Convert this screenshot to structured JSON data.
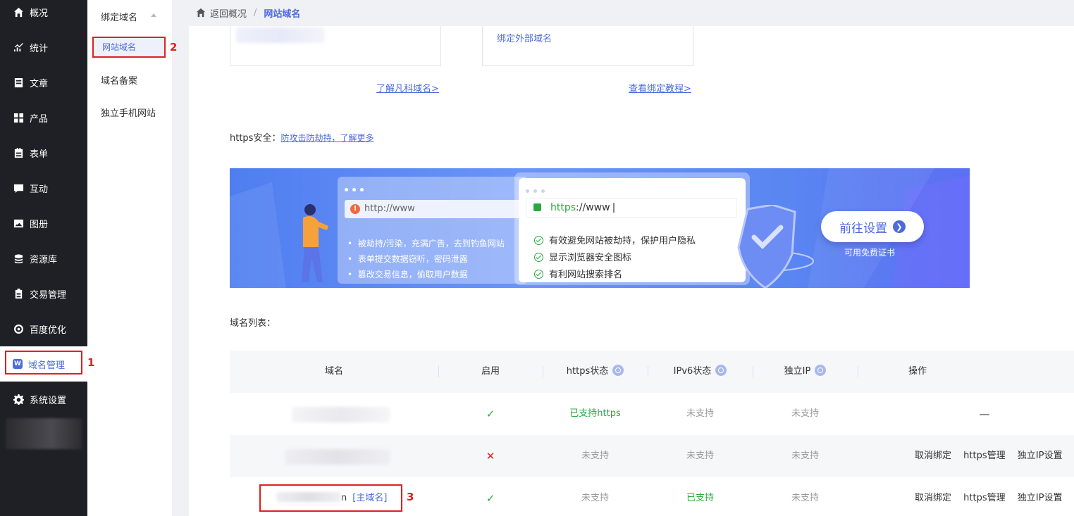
{
  "nav": {
    "items": [
      {
        "label": "概况",
        "icon": "home-icon"
      },
      {
        "label": "统计",
        "icon": "chart-icon"
      },
      {
        "label": "文章",
        "icon": "article-icon"
      },
      {
        "label": "产品",
        "icon": "grid-icon"
      },
      {
        "label": "表单",
        "icon": "form-icon"
      },
      {
        "label": "互动",
        "icon": "chat-icon"
      },
      {
        "label": "图册",
        "icon": "gallery-icon"
      },
      {
        "label": "资源库",
        "icon": "database-icon"
      },
      {
        "label": "交易管理",
        "icon": "clipboard-icon"
      },
      {
        "label": "百度优化",
        "icon": "target-icon"
      },
      {
        "label": "域名管理",
        "icon": "w-icon",
        "badge": "W"
      },
      {
        "label": "系统设置",
        "icon": "gear-icon"
      }
    ]
  },
  "subnav": {
    "group_title": "绑定域名",
    "items": [
      {
        "label": "网站域名"
      },
      {
        "label": "域名备案"
      },
      {
        "label": "独立手机网站"
      }
    ]
  },
  "breadcrumb": {
    "back": "返回概况",
    "separator": "/",
    "current": "网站域名"
  },
  "cards": {
    "right_text": "绑定外部域名",
    "left_link": "了解凡科域名>",
    "right_link": "查看绑定教程>"
  },
  "https_line": {
    "label": "https安全：",
    "link": "防攻击防劫持，了解更多"
  },
  "banner": {
    "bad_url": "http://www",
    "bad_points": [
      "被劫持/污染，充满广告，去到钓鱼网站",
      "表单提交数据窃听，密码泄露",
      "篡改交易信息，偷取用户数据"
    ],
    "good_url_scheme": "https",
    "good_url_rest": "://www",
    "good_points": [
      "有效避免网站被劫持，保护用户隐私",
      "显示浏览器安全图标",
      "有利网站搜索排名"
    ],
    "button": "前往设置",
    "button_arrow": "❯",
    "sub": "可用免费证书"
  },
  "list_title": "域名列表：",
  "table": {
    "headers": [
      "域名",
      "启用",
      "https状态",
      "IPv6状态",
      "独立IP",
      "操作"
    ],
    "rows": [
      {
        "enabled": "✓",
        "https": "已支持https",
        "ipv6": "未支持",
        "ip": "未支持",
        "ops": [],
        "op_dash": "—"
      },
      {
        "enabled": "✕",
        "https": "未支持",
        "ipv6": "未支持",
        "ip": "未支持",
        "ops": [
          "取消绑定",
          "https管理",
          "独立IP设置"
        ]
      },
      {
        "enabled": "✓",
        "https": "未支持",
        "ipv6": "已支持",
        "ip": "未支持",
        "ops": [
          "取消绑定",
          "https管理",
          "独立IP设置"
        ],
        "domain_suffix": "n",
        "tag": "[主域名]"
      }
    ]
  },
  "annotations": [
    "1",
    "2",
    "3"
  ],
  "colors": {
    "accent": "#4d6bdb",
    "nav_bg": "#1f2026",
    "green": "#2aa840",
    "red": "#e02020"
  }
}
